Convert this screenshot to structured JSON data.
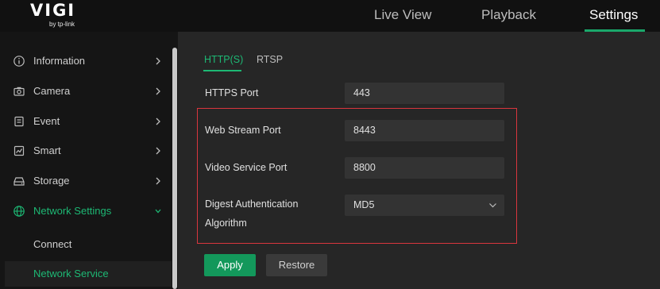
{
  "brand": {
    "logo_text": "VIGI",
    "logo_subtext": "by tp-link"
  },
  "nav": {
    "tabs": [
      {
        "label": "Live View",
        "active": false
      },
      {
        "label": "Playback",
        "active": false
      },
      {
        "label": "Settings",
        "active": true
      }
    ]
  },
  "sidebar": {
    "items": [
      {
        "label": "Information",
        "icon": "info-icon"
      },
      {
        "label": "Camera",
        "icon": "camera-icon"
      },
      {
        "label": "Event",
        "icon": "event-icon"
      },
      {
        "label": "Smart",
        "icon": "smart-icon"
      },
      {
        "label": "Storage",
        "icon": "storage-icon"
      },
      {
        "label": "Network Settings",
        "icon": "globe-icon",
        "expanded": true
      }
    ],
    "subitems": [
      {
        "label": "Connect",
        "selected": false
      },
      {
        "label": "Network Service",
        "selected": true
      }
    ]
  },
  "main": {
    "subtabs": [
      {
        "label": "HTTP(S)",
        "active": true
      },
      {
        "label": "RTSP",
        "active": false
      }
    ],
    "fields": {
      "https_port": {
        "label": "HTTPS Port",
        "value": "443"
      },
      "web_stream_port": {
        "label": "Web Stream Port",
        "value": "8443"
      },
      "video_service_port": {
        "label": "Video Service Port",
        "value": "8800"
      },
      "digest_auth": {
        "label_line1": "Digest Authentication",
        "label_line2": "Algorithm",
        "value": "MD5"
      }
    },
    "buttons": {
      "apply": "Apply",
      "restore": "Restore"
    }
  },
  "colors": {
    "accent": "#1db874",
    "apply_button": "#13985b",
    "highlight_border": "#d9363e",
    "panel": "#262626",
    "sidebar": "#151515"
  }
}
